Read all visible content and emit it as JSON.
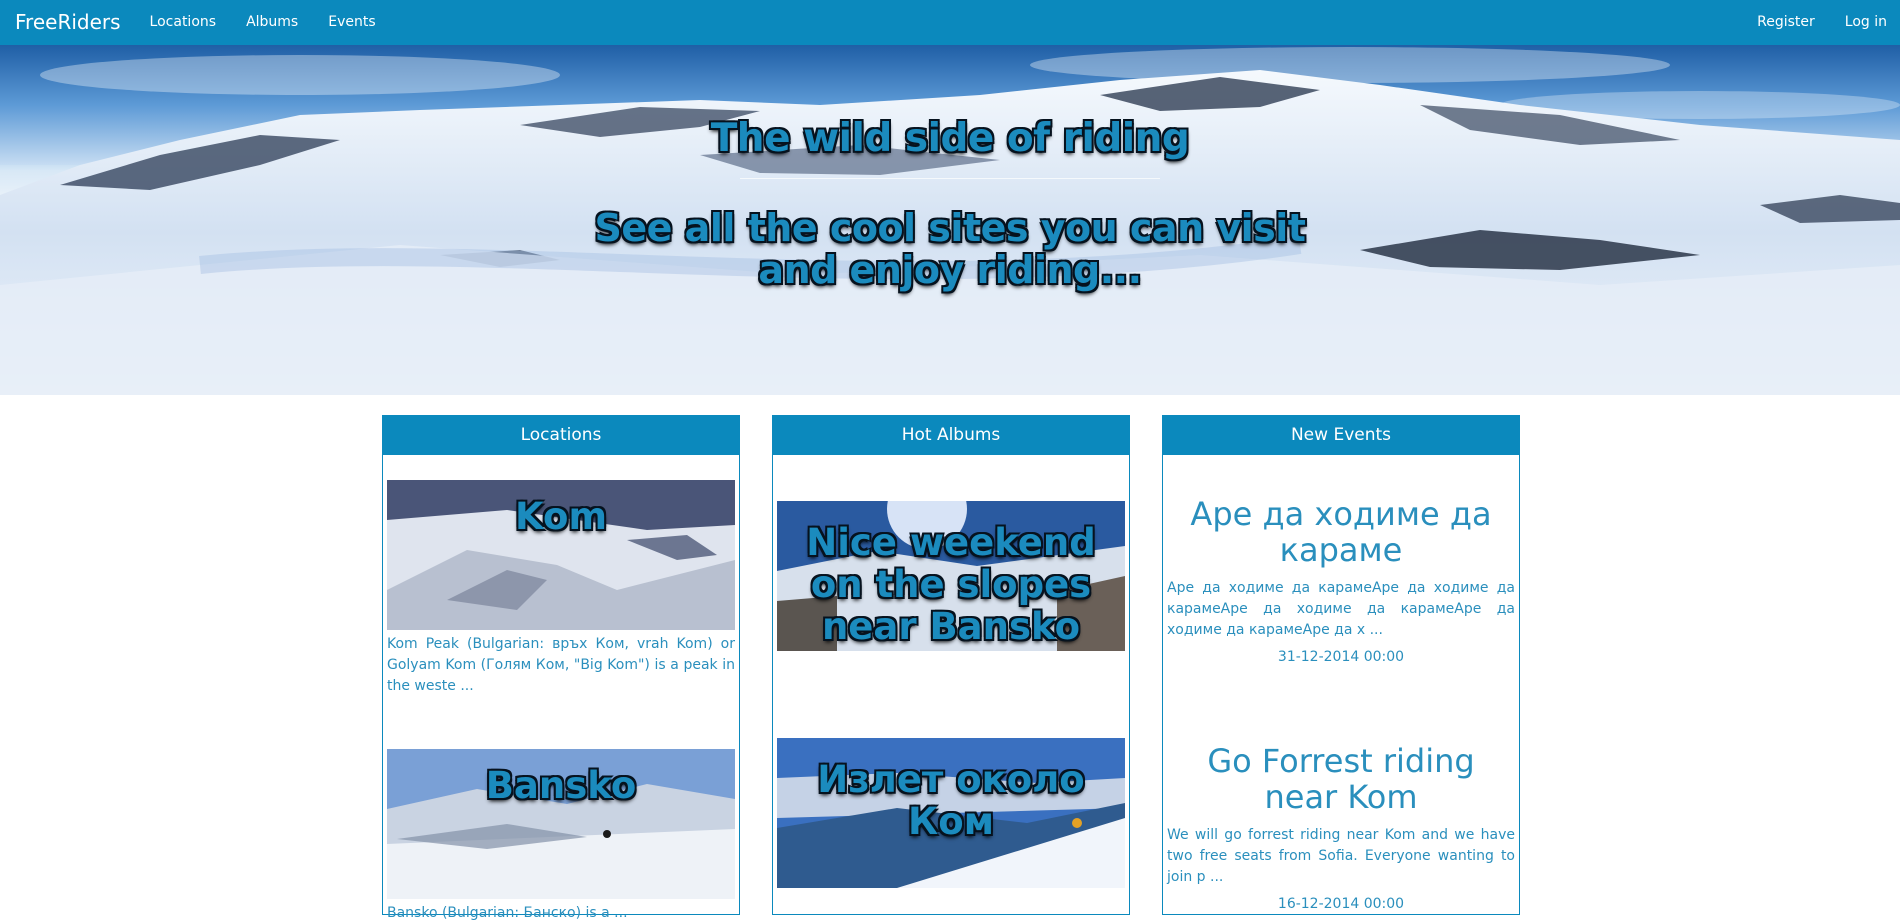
{
  "navbar": {
    "brand": "FreeRiders",
    "links": [
      "Locations",
      "Albums",
      "Events"
    ],
    "right_links": [
      "Register",
      "Log in"
    ],
    "color": "#0b89bd"
  },
  "hero": {
    "title": "The wild side of riding",
    "subtitle": "See all the cool sites you can visit and enjoy riding..."
  },
  "panels": {
    "locations": {
      "heading": "Locations",
      "items": [
        {
          "title": "Kom",
          "description": "Kom Peak (Bulgarian: връх Ком, vrah Kom) or Golyam Kom (Голям Ком, \"Big Kom\") is a peak in the weste ..."
        },
        {
          "title": "Bansko",
          "description": "Bansko (Bulgarian: Банско) is a ..."
        }
      ]
    },
    "albums": {
      "heading": "Hot Albums",
      "items": [
        {
          "title": "Nice weekend on the slopes near Bansko"
        },
        {
          "title": "Излет около Ком"
        }
      ]
    },
    "events": {
      "heading": "New Events",
      "items": [
        {
          "title": "Аре да ходиме да караме",
          "description": "Аре да ходиме да карамеАре да ходиме да карамеАре да ходиме да карамеАре да ходиме да карамеАре да х ...",
          "date": "31-12-2014 00:00"
        },
        {
          "title": "Go Forrest riding near Kom",
          "description": "We will go forrest riding near Kom and we have two free seats from Sofia. Everyone wanting to join p ...",
          "date": "16-12-2014 00:00"
        }
      ]
    }
  }
}
